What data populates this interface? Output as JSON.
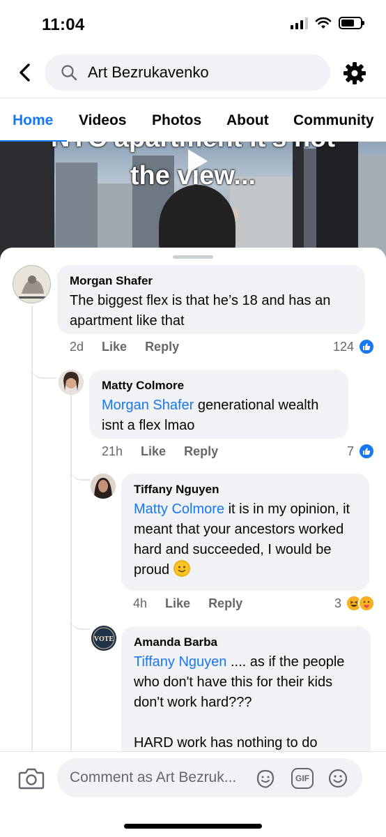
{
  "status_bar": {
    "time": "11:04"
  },
  "header": {
    "search_value": "Art Bezrukavenko"
  },
  "tabs": [
    {
      "label": "Home",
      "active": true
    },
    {
      "label": "Videos",
      "active": false
    },
    {
      "label": "Photos",
      "active": false
    },
    {
      "label": "About",
      "active": false
    },
    {
      "label": "Community",
      "active": false
    }
  ],
  "video": {
    "overlay_line1": "NYC apartment it's not",
    "overlay_line2": "the view..."
  },
  "comments": [
    {
      "author": "Morgan Shafer",
      "mention": "",
      "text": "The biggest flex is that he’s 18 and has an apartment like that",
      "time": "2d",
      "like_label": "Like",
      "reply_label": "Reply",
      "reaction_count": "124",
      "reactions": [
        "like-icon"
      ]
    },
    {
      "author": "Matty Colmore",
      "mention": "Morgan Shafer",
      "text": " generational wealth isnt a flex lmao",
      "time": "21h",
      "like_label": "Like",
      "reply_label": "Reply",
      "reaction_count": "7",
      "reactions": [
        "like-icon"
      ]
    },
    {
      "author": "Tiffany Nguyen",
      "mention": "Matty Colmore",
      "text": " it is in my opinion, it meant that your ancestors worked hard and succeeded, I would be proud",
      "emoji": "slightly-smiling-face-emoji",
      "time": "4h",
      "like_label": "Like",
      "reply_label": "Reply",
      "reaction_count": "3",
      "reactions": [
        "haha-icon",
        "care-icon"
      ]
    },
    {
      "author": "Amanda Barba",
      "mention": "Tiffany Nguyen",
      "text": " .... as if the people who don't have this for their kids don't work hard???",
      "text2": "HARD work has nothing to do",
      "avatar_text": "VOTE"
    }
  ],
  "composer": {
    "placeholder": "Comment as Art Bezruk...",
    "gif_label": "GIF"
  },
  "colors": {
    "accent": "#1877f2",
    "bubble": "#f0f2f5",
    "secondary_text": "#65676b"
  }
}
